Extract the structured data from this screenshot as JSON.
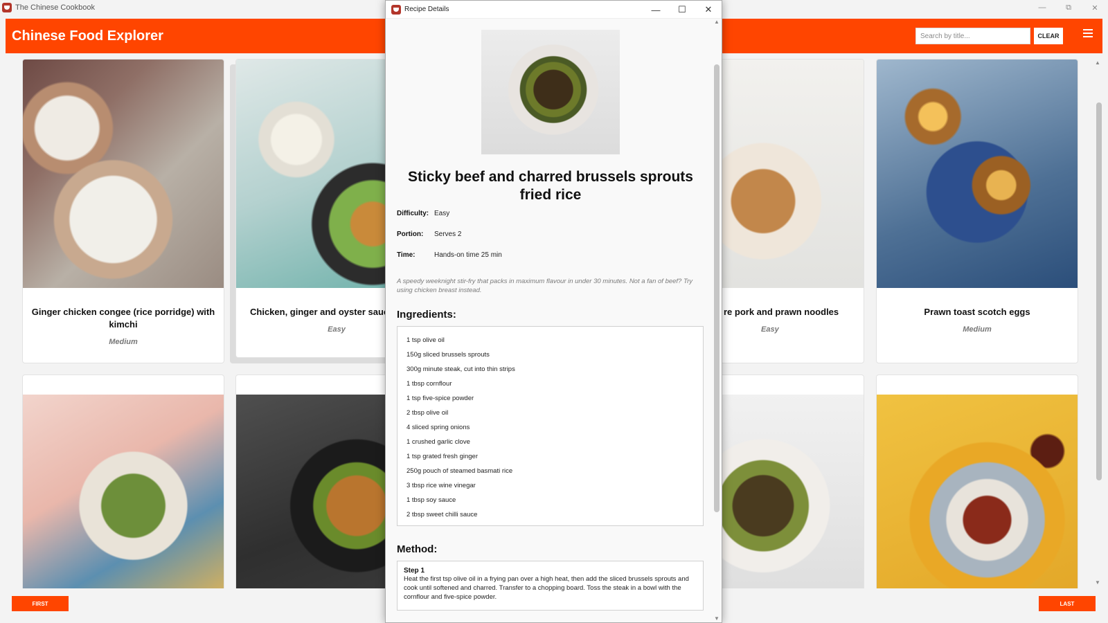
{
  "main_window": {
    "title": "The Chinese Cookbook"
  },
  "header": {
    "app_title": "Chinese Food Explorer",
    "search_placeholder": "Search by title...",
    "clear_label": "CLEAR"
  },
  "cards": [
    {
      "title": "Ginger chicken congee (rice porridge) with kimchi",
      "difficulty": "Medium"
    },
    {
      "title": "Chicken, ginger and oyster sauce",
      "difficulty": "Easy"
    },
    {
      "title": "re pork and prawn noodles",
      "difficulty": "Easy"
    },
    {
      "title": "Prawn toast scotch eggs",
      "difficulty": "Medium"
    }
  ],
  "pagination": {
    "first_label": "FIRST",
    "last_label": "LAST"
  },
  "dialog": {
    "window_title": "Recipe Details",
    "recipe_title": "Sticky beef and charred brussels sprouts fried rice",
    "difficulty_label": "Difficulty:",
    "difficulty_value": "Easy",
    "portion_label": "Portion:",
    "portion_value": "Serves 2",
    "time_label": "Time:",
    "time_value": "Hands-on time 25 min",
    "description": "A speedy weeknight stir-fry that packs in maximum flavour in under 30 minutes. Not a fan of beef? Try using chicken breast instead.",
    "ingredients_heading": "Ingredients:",
    "ingredients": [
      "1 tsp olive oil",
      "150g sliced brussels sprouts",
      "300g minute steak, cut into thin strips",
      "1 tbsp cornflour",
      "1 tsp five-spice powder",
      "2 tbsp olive oil",
      "4 sliced spring onions",
      "1 crushed garlic clove",
      "1 tsp grated fresh ginger",
      "250g pouch of steamed basmati rice",
      "3 tbsp rice wine vinegar",
      "1 tbsp soy sauce",
      "2 tbsp sweet chilli sauce"
    ],
    "method_heading": "Method:",
    "steps": [
      {
        "heading": "Step 1",
        "text": "Heat the first tsp olive oil in a frying pan over a high heat, then add the sliced brussels sprouts and cook until softened and charred. Transfer to a chopping board. Toss the steak in a bowl with the cornflour and five-spice powder."
      }
    ]
  },
  "colors": {
    "accent": "#ff4500"
  }
}
